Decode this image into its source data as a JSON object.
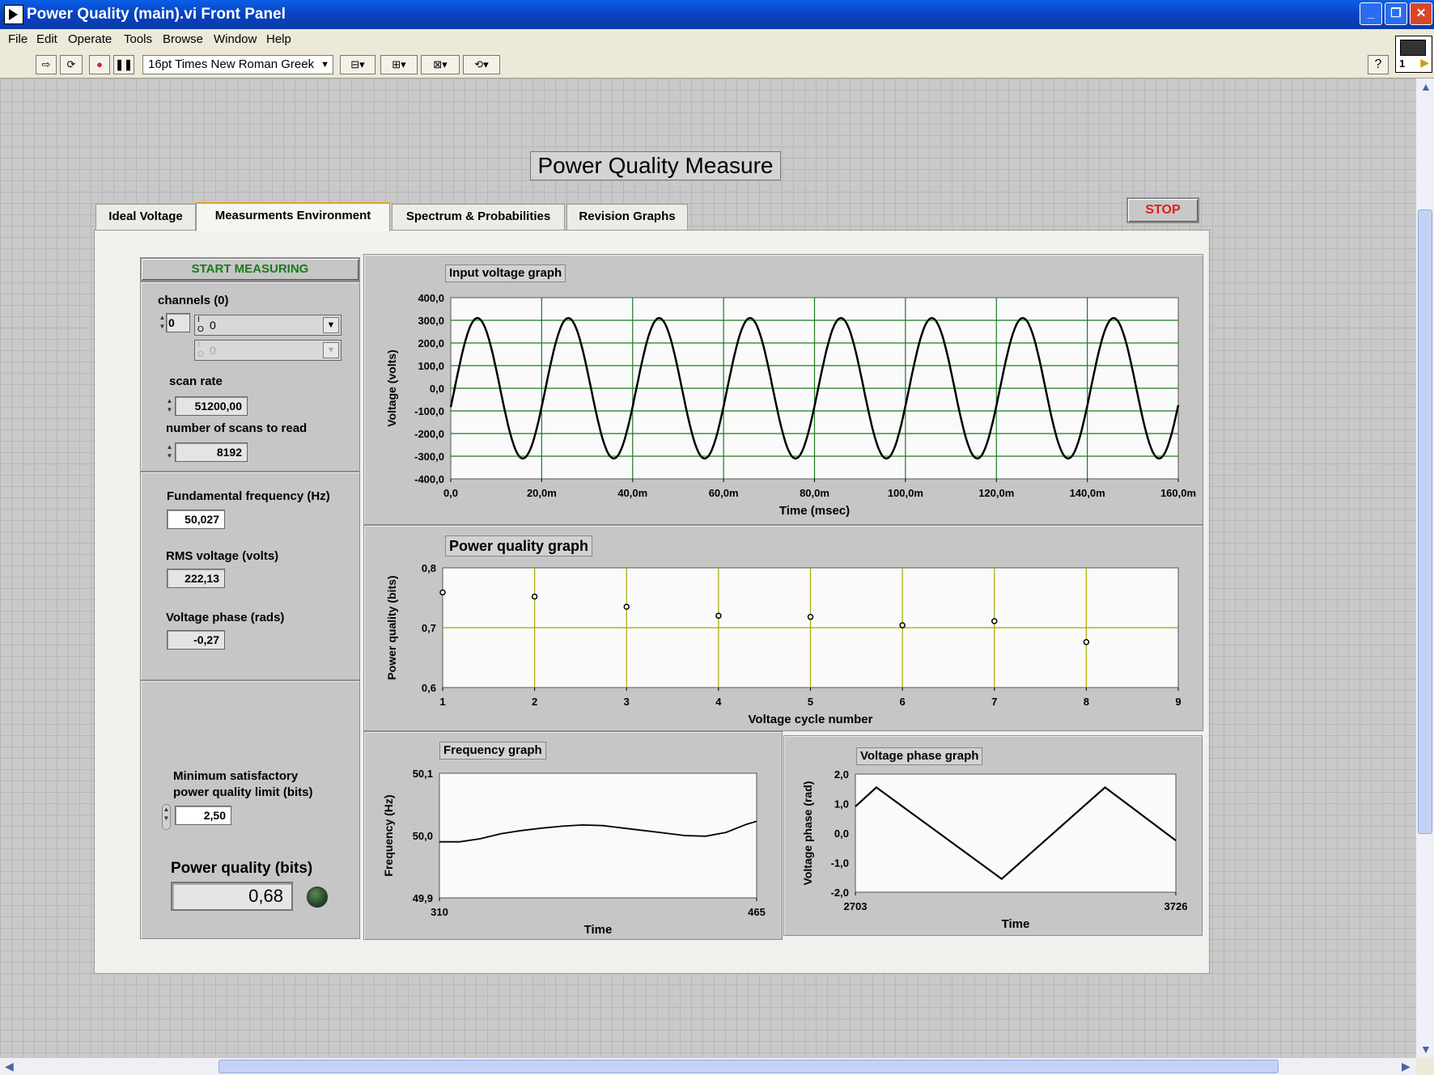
{
  "window": {
    "title": "Power Quality (main).vi Front Panel"
  },
  "menu": [
    "File",
    "Edit",
    "Operate",
    "Tools",
    "Browse",
    "Window",
    "Help"
  ],
  "toolbar": {
    "font": "16pt Times New Roman Greek",
    "help": "?",
    "vi_number": "1"
  },
  "panel": {
    "title": "Power Quality Measure",
    "stop_label": "STOP",
    "tabs": [
      "Ideal Voltage",
      "Measurments Environment",
      "Spectrum & Probabilities",
      "Revision Graphs"
    ],
    "active_tab": "Measurments Environment"
  },
  "controls": {
    "start_label": "START MEASURING",
    "channels_label": "channels (0)",
    "channels_index": "0",
    "channel_1": "0",
    "channel_2": "0",
    "scan_rate_label": "scan rate",
    "scan_rate": "51200,00",
    "scans_label": "number of scans to read",
    "scans": "8192",
    "fund_freq_label": "Fundamental frequency (Hz)",
    "fund_freq": "50,027",
    "rms_label": "RMS voltage (volts)",
    "rms": "222,13",
    "phase_label": "Voltage phase (rads)",
    "phase": "-0,27",
    "min_limit_label_1": "Minimum satisfactory",
    "min_limit_label_2": "power quality limit (bits)",
    "min_limit": "2,50",
    "pq_label": "Power quality (bits)",
    "pq_value": "0,68",
    "pq_led": "off"
  },
  "colors": {
    "grid_green": "#1e7a1e",
    "grid_olive": "#a8a800",
    "trace": "#000000",
    "stop_text": "#e02010",
    "start_text": "#1a7a1a"
  },
  "chart_data": [
    {
      "type": "line",
      "title": "Input voltage graph",
      "xlabel": "Time (msec)",
      "ylabel": "Voltage (volts)",
      "xlim": [
        0,
        0.16
      ],
      "ylim": [
        -400,
        400
      ],
      "x_ticks": [
        "0,0",
        "20,0m",
        "40,0m",
        "60,0m",
        "80,0m",
        "100,0m",
        "120,0m",
        "140,0m",
        "160,0m"
      ],
      "y_ticks": [
        "400,0",
        "300,0",
        "200,0",
        "100,0",
        "0,0",
        "-100,0",
        "-200,0",
        "-300,0",
        "-400,0"
      ],
      "series": [
        {
          "frequency_hz": 50.027,
          "amplitude": 310,
          "phase_rad": -0.27
        }
      ],
      "grid": true
    },
    {
      "type": "scatter",
      "title": "Power quality graph",
      "xlabel": "Voltage cycle number",
      "ylabel": "Power quality (bits)",
      "xlim": [
        1,
        9
      ],
      "ylim": [
        0.6,
        0.8
      ],
      "x_ticks": [
        "1",
        "2",
        "3",
        "4",
        "5",
        "6",
        "7",
        "8",
        "9"
      ],
      "y_ticks": [
        "0,8",
        "0,7",
        "0,6"
      ],
      "x": [
        1,
        2,
        3,
        4,
        5,
        6,
        7,
        8
      ],
      "y": [
        0.759,
        0.752,
        0.735,
        0.72,
        0.718,
        0.704,
        0.711,
        0.676
      ],
      "grid": true
    },
    {
      "type": "line",
      "title": "Frequency graph",
      "xlabel": "Time",
      "ylabel": "Frequency (Hz)",
      "xlim": [
        310,
        465
      ],
      "ylim": [
        49.9,
        50.1
      ],
      "x_ticks": [
        "310",
        "465"
      ],
      "y_ticks": [
        "50,1",
        "50,0",
        "49,9"
      ],
      "x": [
        310,
        320,
        330,
        340,
        350,
        360,
        370,
        380,
        390,
        400,
        410,
        420,
        430,
        440,
        450,
        460,
        465
      ],
      "y": [
        49.99,
        49.99,
        49.995,
        50.003,
        50.008,
        50.012,
        50.015,
        50.017,
        50.016,
        50.012,
        50.008,
        50.004,
        50.0,
        49.999,
        50.005,
        50.018,
        50.023
      ],
      "grid": false
    },
    {
      "type": "line",
      "title": "Voltage phase graph",
      "xlabel": "Time",
      "ylabel": "Voltage phase (rad)",
      "xlim": [
        2703,
        3726
      ],
      "ylim": [
        -2.0,
        2.0
      ],
      "x_ticks": [
        "2703",
        "3726"
      ],
      "y_ticks": [
        "2,0",
        "1,0",
        "0,0",
        "-1,0",
        "-2,0"
      ],
      "x": [
        2703,
        2770,
        3170,
        3500,
        3726
      ],
      "y": [
        0.9,
        1.55,
        -1.55,
        1.55,
        -0.25
      ],
      "grid": false
    }
  ]
}
